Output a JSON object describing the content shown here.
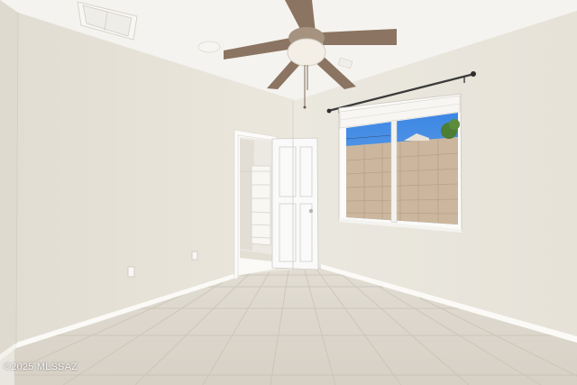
{
  "watermark": {
    "text": "©2025 MLSSAZ"
  },
  "colors": {
    "wall_left": "#e8e4da",
    "wall_right": "#eae6dc",
    "ceiling": "#f4f2ee",
    "floor_tile": "#dcd7cd",
    "baseboard": "#fbfaf7",
    "door": "#fafafa",
    "sky": "#4a8fe0",
    "block_wall": "#cdb9a0",
    "fan_blade": "#8a7260"
  }
}
